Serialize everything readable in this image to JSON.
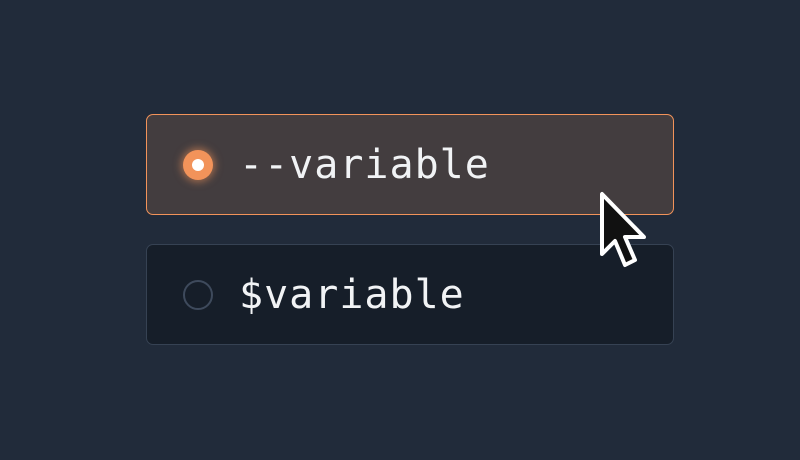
{
  "options": [
    {
      "label": "--variable",
      "selected": true
    },
    {
      "label": "$variable",
      "selected": false
    }
  ],
  "colors": {
    "background": "#212b3a",
    "accent": "#f2935a",
    "selected_fill": "#433d3f",
    "unselected_fill": "#161e29",
    "text": "#f1f3f5"
  },
  "icons": {
    "pointer": "mouse-pointer-icon"
  }
}
